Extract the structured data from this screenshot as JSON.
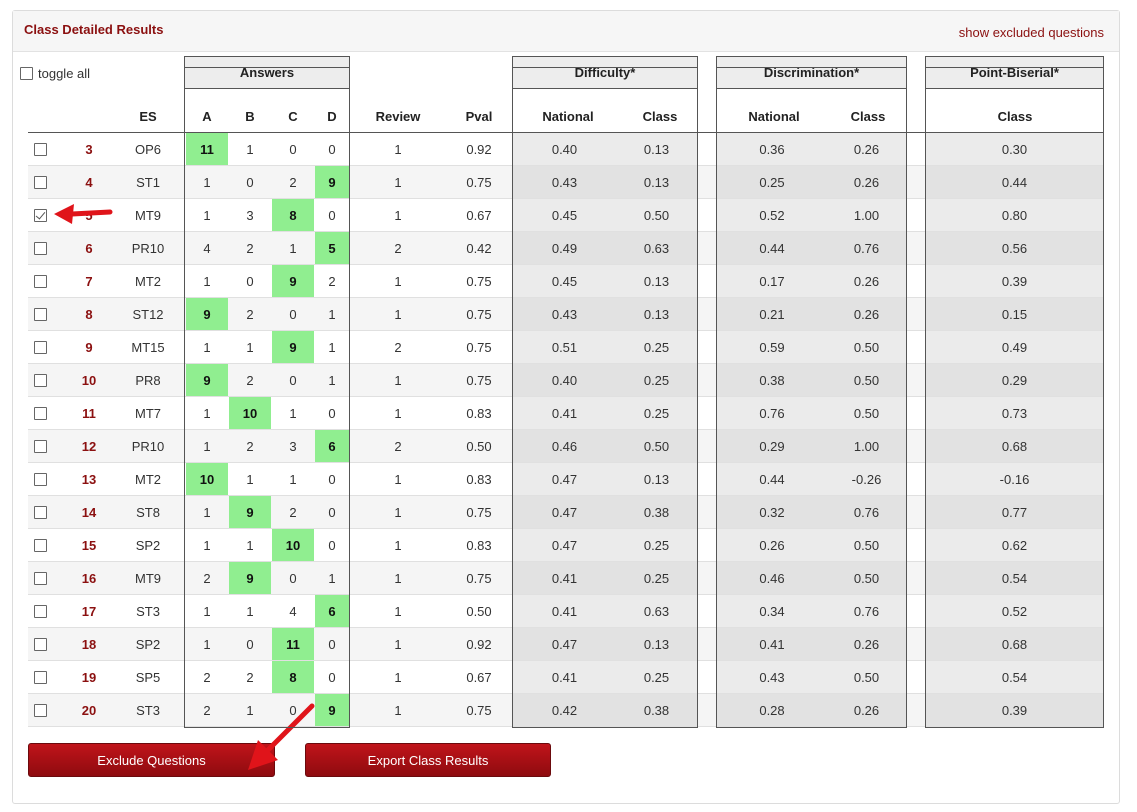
{
  "panel": {
    "title": "Class Detailed Results",
    "show_excluded_label": "show excluded questions",
    "toggle_all_label": "toggle all"
  },
  "table": {
    "groups": {
      "answers": "Answers",
      "difficulty": "Difficulty*",
      "discrimination": "Discrimination*",
      "point_biserial": "Point-Biserial*"
    },
    "headers": {
      "es": "ES",
      "a": "A",
      "b": "B",
      "c": "C",
      "d": "D",
      "review": "Review",
      "pval": "Pval",
      "diff_national": "National",
      "diff_class": "Class",
      "disc_national": "National",
      "disc_class": "Class",
      "pb_class": "Class"
    },
    "rows": [
      {
        "num": "3",
        "es": "OP6",
        "a": "11",
        "b": "1",
        "c": "0",
        "d": "0",
        "correct": "a",
        "review": "1",
        "pval": "0.92",
        "diff_national": "0.40",
        "diff_class": "0.13",
        "disc_national": "0.36",
        "disc_class": "0.26",
        "pb_class": "0.30",
        "checked": false
      },
      {
        "num": "4",
        "es": "ST1",
        "a": "1",
        "b": "0",
        "c": "2",
        "d": "9",
        "correct": "d",
        "review": "1",
        "pval": "0.75",
        "diff_national": "0.43",
        "diff_class": "0.13",
        "disc_national": "0.25",
        "disc_class": "0.26",
        "pb_class": "0.44",
        "checked": false
      },
      {
        "num": "5",
        "es": "MT9",
        "a": "1",
        "b": "3",
        "c": "8",
        "d": "0",
        "correct": "c",
        "review": "1",
        "pval": "0.67",
        "diff_national": "0.45",
        "diff_class": "0.50",
        "disc_national": "0.52",
        "disc_class": "1.00",
        "pb_class": "0.80",
        "checked": true
      },
      {
        "num": "6",
        "es": "PR10",
        "a": "4",
        "b": "2",
        "c": "1",
        "d": "5",
        "correct": "d",
        "review": "2",
        "pval": "0.42",
        "diff_national": "0.49",
        "diff_class": "0.63",
        "disc_national": "0.44",
        "disc_class": "0.76",
        "pb_class": "0.56",
        "checked": false
      },
      {
        "num": "7",
        "es": "MT2",
        "a": "1",
        "b": "0",
        "c": "9",
        "d": "2",
        "correct": "c",
        "review": "1",
        "pval": "0.75",
        "diff_national": "0.45",
        "diff_class": "0.13",
        "disc_national": "0.17",
        "disc_class": "0.26",
        "pb_class": "0.39",
        "checked": false
      },
      {
        "num": "8",
        "es": "ST12",
        "a": "9",
        "b": "2",
        "c": "0",
        "d": "1",
        "correct": "a",
        "review": "1",
        "pval": "0.75",
        "diff_national": "0.43",
        "diff_class": "0.13",
        "disc_national": "0.21",
        "disc_class": "0.26",
        "pb_class": "0.15",
        "checked": false
      },
      {
        "num": "9",
        "es": "MT15",
        "a": "1",
        "b": "1",
        "c": "9",
        "d": "1",
        "correct": "c",
        "review": "2",
        "pval": "0.75",
        "diff_national": "0.51",
        "diff_class": "0.25",
        "disc_national": "0.59",
        "disc_class": "0.50",
        "pb_class": "0.49",
        "checked": false
      },
      {
        "num": "10",
        "es": "PR8",
        "a": "9",
        "b": "2",
        "c": "0",
        "d": "1",
        "correct": "a",
        "review": "1",
        "pval": "0.75",
        "diff_national": "0.40",
        "diff_class": "0.25",
        "disc_national": "0.38",
        "disc_class": "0.50",
        "pb_class": "0.29",
        "checked": false
      },
      {
        "num": "11",
        "es": "MT7",
        "a": "1",
        "b": "10",
        "c": "1",
        "d": "0",
        "correct": "b",
        "review": "1",
        "pval": "0.83",
        "diff_national": "0.41",
        "diff_class": "0.25",
        "disc_national": "0.76",
        "disc_class": "0.50",
        "pb_class": "0.73",
        "checked": false
      },
      {
        "num": "12",
        "es": "PR10",
        "a": "1",
        "b": "2",
        "c": "3",
        "d": "6",
        "correct": "d",
        "review": "2",
        "pval": "0.50",
        "diff_national": "0.46",
        "diff_class": "0.50",
        "disc_national": "0.29",
        "disc_class": "1.00",
        "pb_class": "0.68",
        "checked": false
      },
      {
        "num": "13",
        "es": "MT2",
        "a": "10",
        "b": "1",
        "c": "1",
        "d": "0",
        "correct": "a",
        "review": "1",
        "pval": "0.83",
        "diff_national": "0.47",
        "diff_class": "0.13",
        "disc_national": "0.44",
        "disc_class": "-0.26",
        "pb_class": "-0.16",
        "checked": false
      },
      {
        "num": "14",
        "es": "ST8",
        "a": "1",
        "b": "9",
        "c": "2",
        "d": "0",
        "correct": "b",
        "review": "1",
        "pval": "0.75",
        "diff_national": "0.47",
        "diff_class": "0.38",
        "disc_national": "0.32",
        "disc_class": "0.76",
        "pb_class": "0.77",
        "checked": false
      },
      {
        "num": "15",
        "es": "SP2",
        "a": "1",
        "b": "1",
        "c": "10",
        "d": "0",
        "correct": "c",
        "review": "1",
        "pval": "0.83",
        "diff_national": "0.47",
        "diff_class": "0.25",
        "disc_national": "0.26",
        "disc_class": "0.50",
        "pb_class": "0.62",
        "checked": false
      },
      {
        "num": "16",
        "es": "MT9",
        "a": "2",
        "b": "9",
        "c": "0",
        "d": "1",
        "correct": "b",
        "review": "1",
        "pval": "0.75",
        "diff_national": "0.41",
        "diff_class": "0.25",
        "disc_national": "0.46",
        "disc_class": "0.50",
        "pb_class": "0.54",
        "checked": false
      },
      {
        "num": "17",
        "es": "ST3",
        "a": "1",
        "b": "1",
        "c": "4",
        "d": "6",
        "correct": "d",
        "review": "1",
        "pval": "0.50",
        "diff_national": "0.41",
        "diff_class": "0.63",
        "disc_national": "0.34",
        "disc_class": "0.76",
        "pb_class": "0.52",
        "checked": false
      },
      {
        "num": "18",
        "es": "SP2",
        "a": "1",
        "b": "0",
        "c": "11",
        "d": "0",
        "correct": "c",
        "review": "1",
        "pval": "0.92",
        "diff_national": "0.47",
        "diff_class": "0.13",
        "disc_national": "0.41",
        "disc_class": "0.26",
        "pb_class": "0.68",
        "checked": false
      },
      {
        "num": "19",
        "es": "SP5",
        "a": "2",
        "b": "2",
        "c": "8",
        "d": "0",
        "correct": "c",
        "review": "1",
        "pval": "0.67",
        "diff_national": "0.41",
        "diff_class": "0.25",
        "disc_national": "0.43",
        "disc_class": "0.50",
        "pb_class": "0.54",
        "checked": false
      },
      {
        "num": "20",
        "es": "ST3",
        "a": "2",
        "b": "1",
        "c": "0",
        "d": "9",
        "correct": "d",
        "review": "1",
        "pval": "0.75",
        "diff_national": "0.42",
        "diff_class": "0.38",
        "disc_national": "0.28",
        "disc_class": "0.26",
        "pb_class": "0.39",
        "checked": false
      }
    ]
  },
  "buttons": {
    "exclude": "Exclude Questions",
    "export": "Export Class Results"
  },
  "colors": {
    "brand": "#8b1010",
    "correct_answer": "#90ee90",
    "button": "#b0121a",
    "annotation_arrow": "#e0141a"
  }
}
